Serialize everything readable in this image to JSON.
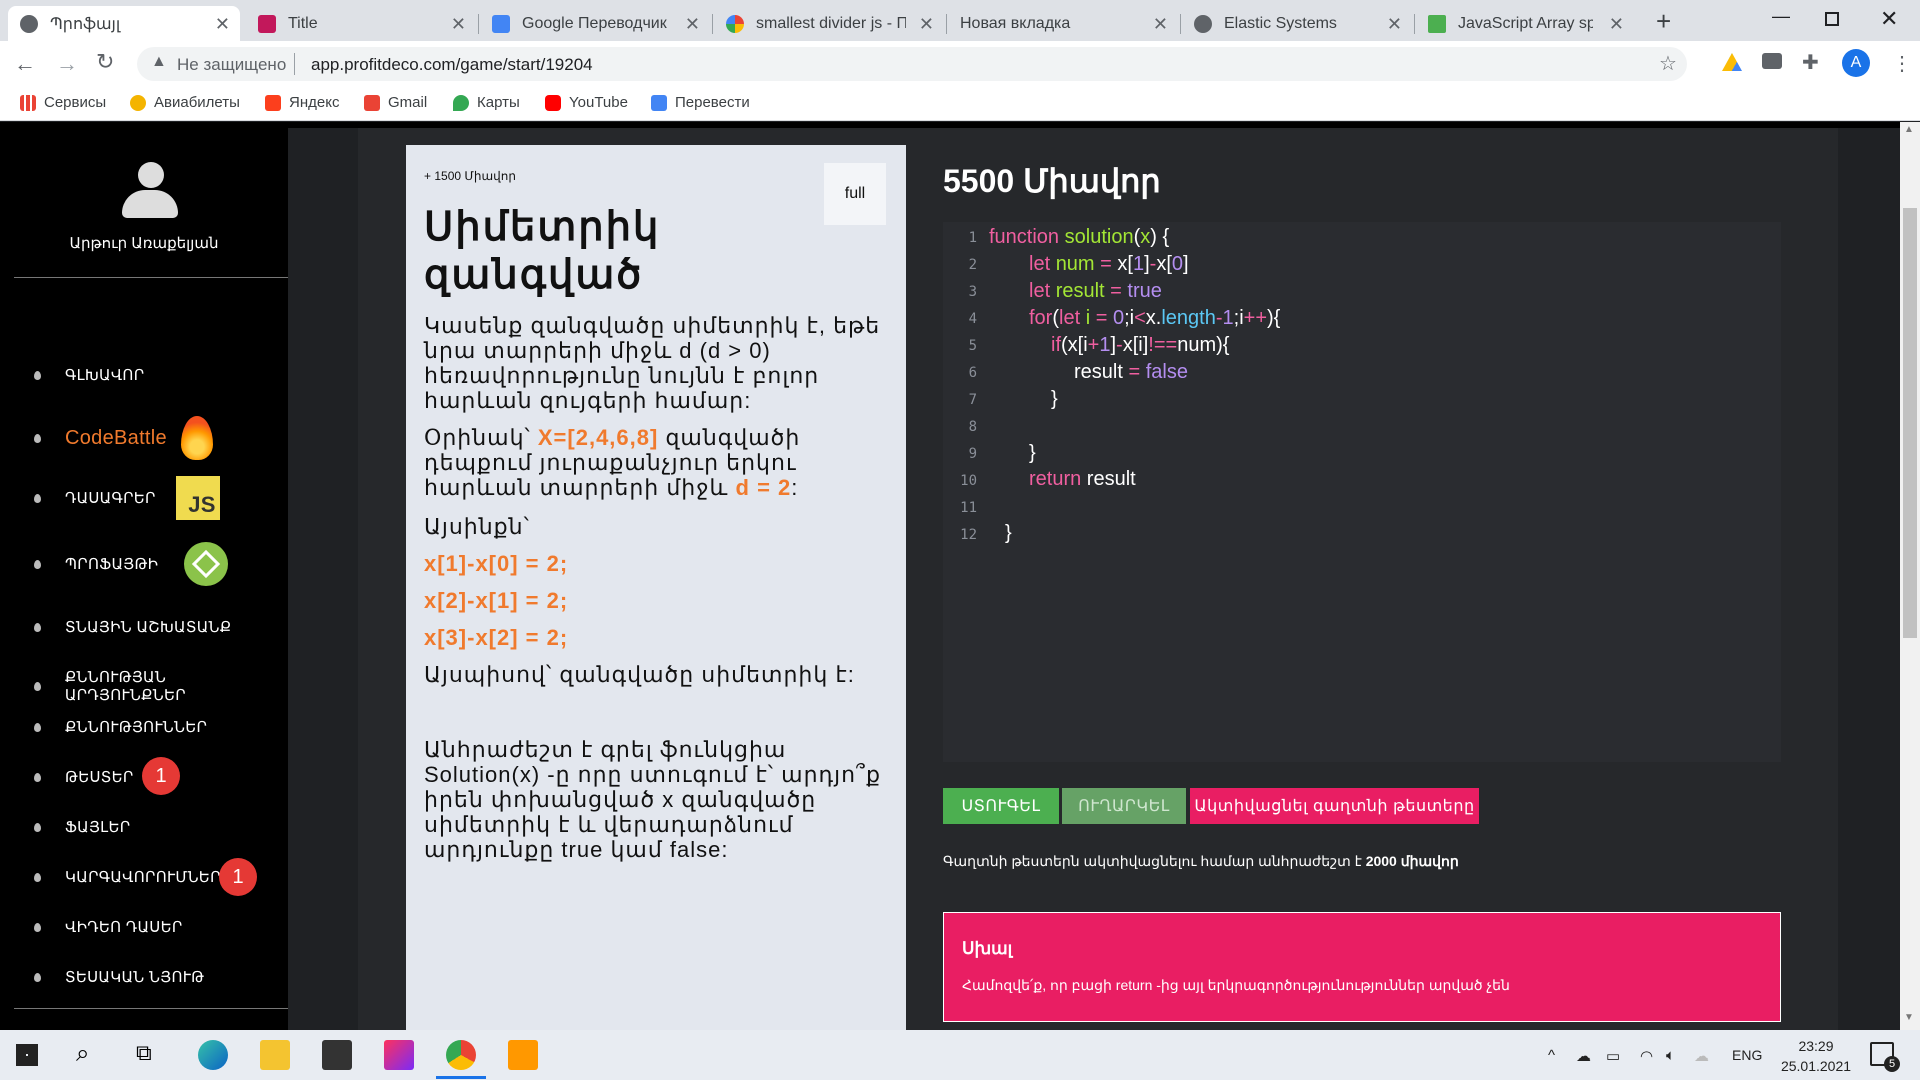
{
  "browser": {
    "tabs": [
      {
        "title": "Պրոֆայլ",
        "active": true
      },
      {
        "title": "Title"
      },
      {
        "title": "Google Переводчик"
      },
      {
        "title": "smallest divider js - По"
      },
      {
        "title": "Новая вкладка"
      },
      {
        "title": "Elastic Systems"
      },
      {
        "title": "JavaScript Array splice("
      }
    ],
    "new_tab": "+",
    "security": "Не защищено",
    "url": "app.profitdeco.com/game/start/19204",
    "profile_initial": "A",
    "bookmarks": [
      {
        "label": "Сервисы"
      },
      {
        "label": "Авиабилеты"
      },
      {
        "label": "Яндекс"
      },
      {
        "label": "Gmail"
      },
      {
        "label": "Карты"
      },
      {
        "label": "YouTube"
      },
      {
        "label": "Перевести"
      }
    ]
  },
  "sidebar": {
    "user_name": "Արթուր Առաքելյան",
    "items": [
      {
        "label": "ԳԼԽԱՎՈՐ"
      },
      {
        "label": "CodeBattle"
      },
      {
        "label": "ԴԱՍԱԳՐԵՐ",
        "badge_text": "JS"
      },
      {
        "label": "ՊՐՈՖԱՅԹԻ"
      },
      {
        "label": "ՏՆԱՅԻՆ ԱՇԽԱՏԱՆՔ"
      },
      {
        "label": "ՔՆՆՈՒԹՅԱՆ ԱՐԴՅՈՒՆՔՆԵՐ"
      },
      {
        "label": "ՔՆՆՈՒԹՅՈՒՆՆԵՐ"
      },
      {
        "label": "ԹԵՍՏԵՐ",
        "count": "1"
      },
      {
        "label": "ՖԱՅԼԵՐ"
      },
      {
        "label": "ԿԱՐԳԱՎՈՐՈՒՄՆԵՐ",
        "count": "1"
      },
      {
        "label": "ՎԻԴԵՈ ԴԱՍԵՐ"
      },
      {
        "label": "ՏԵՍԱԿԱՆ ՆՅՈՒԹ"
      }
    ]
  },
  "task": {
    "reward": "+ 1500 Միավոր",
    "full_button": "full",
    "title_line1": "Սիմետրիկ",
    "title_line2": "զանգված",
    "p1": "Կասենք զանգվածը սիմետրիկ է, եթե նրա տարրերի միջև d (d > 0) հեռավորությունը նույնն է բոլոր հարևան զույգերի համար:",
    "p2_pre": "Օրինակ՝ ",
    "p2_hl1": "X=[2,4,6,8]",
    "p2_mid": " զանգվածի դեպքում յուրաքանչյուր երկու հարևան տարրերի միջև ",
    "p2_hl2": "d = 2",
    "p2_post": ":",
    "p3": "Այսինքն՝",
    "eq1": "x[1]-x[0] = 2;",
    "eq2": "x[2]-x[1] = 2;",
    "eq3": "x[3]-x[2] = 2;",
    "p4": "Այսպիսով՝ զանգվածը սիմետրիկ է:",
    "p5": "Անհրաժեշտ է գրել ֆունկցիա Solution(x) -ը որը ստուգում է՝ արդյո՞ք իրեն փոխանցված x զանգվածը սիմետրիկ է և վերադարձնում արդյունքը true կամ false:"
  },
  "game": {
    "points": "5500 Միավոր",
    "line_numbers": [
      "1",
      "2",
      "3",
      "4",
      "5",
      "6",
      "7",
      "8",
      "9",
      "10",
      "11",
      "12"
    ],
    "check_button": "ՍՏՈՒԳԵԼ",
    "send_button": "ՈՒՂԱՐԿԵԼ",
    "activate_button": "Ակտիվացնել գաղտնի թեստերը",
    "secret_note_pre": "Գաղտնի թեստերն ակտիվացնելու համար անհրաժեշտ է ",
    "secret_note_bold": "2000 միավոր",
    "error_title": "Սխալ",
    "error_text": "Համոզվե՛ք, որ բացի return -ից այլ երկրագործությունություններ արված չեն"
  },
  "taskbar": {
    "lang": "ENG",
    "time": "23:29",
    "date": "25.01.2021",
    "notifications": "5"
  },
  "colors": {
    "accent_orange": "#f07a2d",
    "green_button": "#4caf50",
    "pink": "#e91e63",
    "code_keyword": "#f05fa0",
    "code_function": "#a3e635"
  }
}
